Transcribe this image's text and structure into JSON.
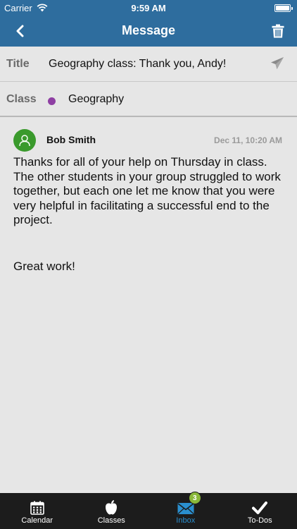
{
  "status_bar": {
    "carrier": "Carrier",
    "time": "9:59 AM",
    "battery_level": 1.0
  },
  "nav": {
    "title": "Message",
    "back_icon": "chevron-left-icon",
    "trash_icon": "trash-icon"
  },
  "fields": {
    "title_label": "Title",
    "title_value": "Geography class: Thank you, Andy!",
    "send_icon": "paper-plane-icon",
    "class_label": "Class",
    "class_value": "Geography",
    "class_color": "#8e3fa3"
  },
  "message": {
    "sender": "Bob Smith",
    "date": "Dec 11, 10:20 AM",
    "avatar_color": "#3a9a2c",
    "body": "Thanks for all of your help on Thursday in class.  The other students in your group struggled to work together, but each one let me know that you were very helpful in facilitating a successful end to the project.",
    "signoff": "Great work!"
  },
  "tabs": [
    {
      "label": "Calendar",
      "icon": "calendar-icon",
      "active": false
    },
    {
      "label": "Classes",
      "icon": "apple-icon",
      "active": false
    },
    {
      "label": "Inbox",
      "icon": "envelope-icon",
      "active": true,
      "badge": "3"
    },
    {
      "label": "To-Dos",
      "icon": "checkmark-icon",
      "active": false
    }
  ],
  "colors": {
    "header_bg": "#2e6d9e",
    "tab_active": "#2a8fcf",
    "badge_bg": "#8ab83a"
  }
}
